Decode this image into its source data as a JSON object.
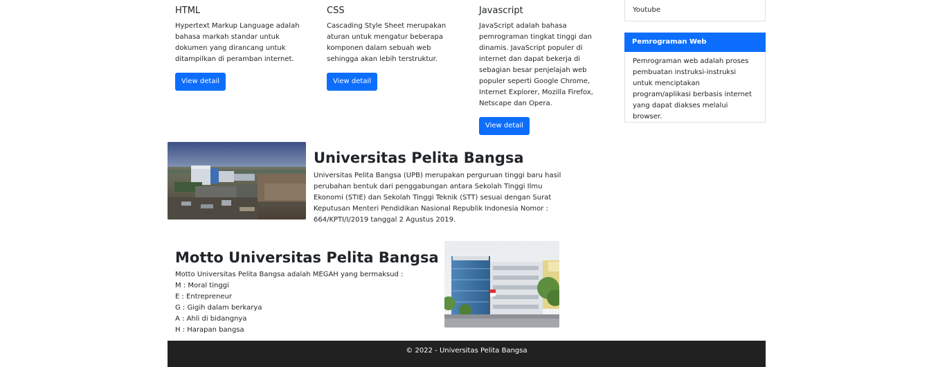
{
  "cards": [
    {
      "title": "HTML",
      "text": "Hypertext Markup Language adalah bahasa markah standar untuk dokumen yang dirancang untuk ditampilkan di peramban internet.",
      "button": "View detail"
    },
    {
      "title": "CSS",
      "text": "Cascading Style Sheet merupakan aturan untuk mengatur beberapa komponen dalam sebuah web sehingga akan lebih terstruktur.",
      "button": "View detail"
    },
    {
      "title": "Javascript",
      "text": "JavaScript adalah bahasa pemrograman tingkat tinggi dan dinamis. JavaScript populer di internet dan dapat bekerja di sebagian besar penjelajah web populer seperti Google Chrome, Internet Explorer, Mozilla Firefox, Netscape dan Opera.",
      "button": "View detail"
    }
  ],
  "sidebar": {
    "link": "Youtube",
    "widget_title": "Pemrograman Web",
    "widget_text": "Pemrograman web adalah proses pembuatan instruksi-instruksi untuk menciptakan program/aplikasi berbasis internet yang dapat diakses melalui browser."
  },
  "university": {
    "title": "Universitas Pelita Bangsa",
    "text": "Universitas Pelita Bangsa (UPB) merupakan perguruan tinggi baru hasil perubahan bentuk dari penggabungan antara Sekolah Tinggi Ilmu Ekonomi (STIE) dan Sekolah Tinggi Teknik (STT) sesuai dengan Surat Keputusan Menteri Pendidikan Nasional Republik Indonesia Nomor : 664/KPTI/I/2019 tanggal 2 Agustus 2019."
  },
  "motto": {
    "title": "Motto Universitas Pelita Bangsa",
    "intro": "Motto Universitas Pelita Bangsa adalah MEGAH yang bermaksud :",
    "items": [
      "M : Moral tinggi",
      "E : Entrepreneur",
      "G : Gigih dalam berkarya",
      "A : Ahli di bidangnya",
      "H : Harapan bangsa"
    ]
  },
  "footer": {
    "text": "© 2022 - Universitas Pelita Bangsa"
  },
  "colors": {
    "primary": "#0d6efd",
    "footer_bg": "#212121",
    "text": "#212529"
  }
}
